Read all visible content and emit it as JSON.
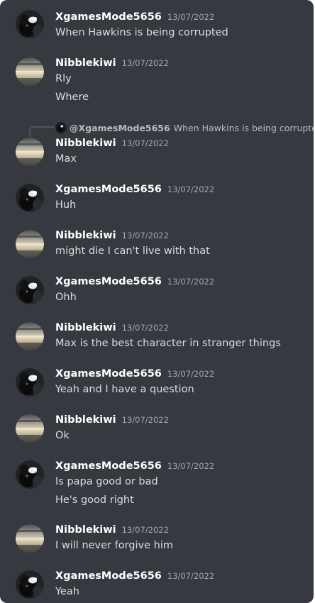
{
  "users": {
    "xgames": {
      "name": "XgamesMode5656",
      "avatar": "dog-avatar"
    },
    "nibble": {
      "name": "Nibblekiwi",
      "avatar": "sunset-avatar"
    }
  },
  "reply": {
    "mention": "@XgamesMode5656",
    "text": "When Hawkins is being corrupted"
  },
  "messages": [
    {
      "author": "XgamesMode5656",
      "date": "13/07/2022",
      "lines": [
        "When Hawkins is being corrupted"
      ]
    },
    {
      "author": "Nibblekiwi",
      "date": "13/07/2022",
      "lines": [
        "Rly",
        "Where"
      ]
    },
    {
      "author": "Nibblekiwi",
      "date": "13/07/2022",
      "lines": [
        "Max"
      ]
    },
    {
      "author": "XgamesMode5656",
      "date": "13/07/2022",
      "lines": [
        "Huh"
      ]
    },
    {
      "author": "Nibblekiwi",
      "date": "13/07/2022",
      "lines": [
        "might die I can't live with that"
      ]
    },
    {
      "author": "XgamesMode5656",
      "date": "13/07/2022",
      "lines": [
        "Ohh"
      ]
    },
    {
      "author": "Nibblekiwi",
      "date": "13/07/2022",
      "lines": [
        "Max is the best character in stranger things"
      ]
    },
    {
      "author": "XgamesMode5656",
      "date": "13/07/2022",
      "lines": [
        "Yeah and I have a question"
      ]
    },
    {
      "author": "Nibblekiwi",
      "date": "13/07/2022",
      "lines": [
        "Ok"
      ]
    },
    {
      "author": "XgamesMode5656",
      "date": "13/07/2022",
      "lines": [
        "Is papa good or bad",
        "He's good right"
      ]
    },
    {
      "author": "Nibblekiwi",
      "date": "13/07/2022",
      "lines": [
        "I will never forgive him"
      ]
    },
    {
      "author": "XgamesMode5656",
      "date": "13/07/2022",
      "lines": [
        "Yeah"
      ]
    }
  ],
  "colors": {
    "background": "#36393f",
    "username": "#ffffff",
    "timestamp": "#a3a6aa",
    "message_text": "#dcddde"
  }
}
